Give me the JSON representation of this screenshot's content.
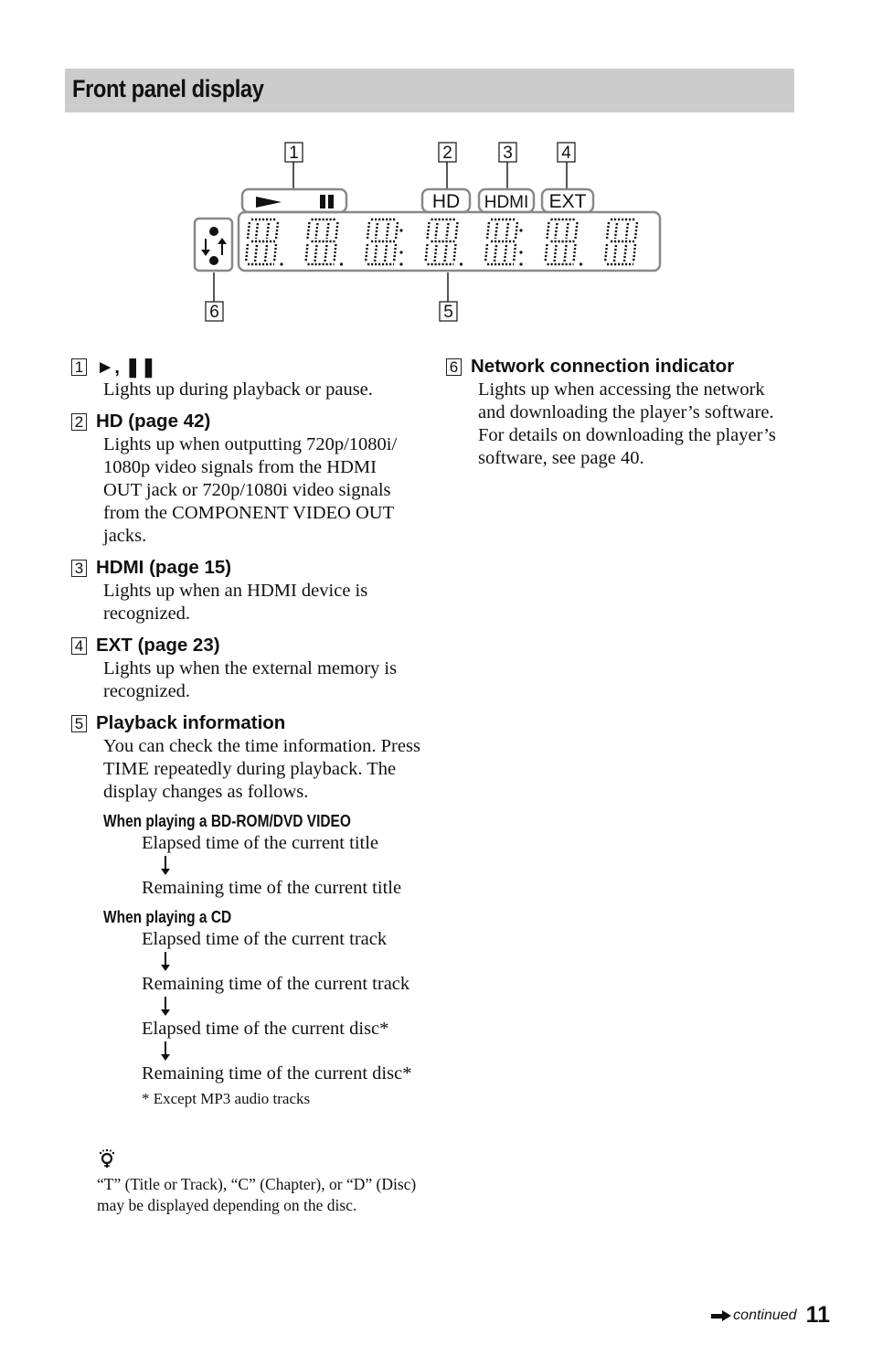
{
  "section": {
    "title": "Front panel display"
  },
  "diagram": {
    "callouts": [
      "1",
      "2",
      "3",
      "4",
      "5",
      "6"
    ],
    "indicators": {
      "hd": "HD",
      "hdmi": "HDMI",
      "ext": "EXT"
    },
    "digit_count": 7
  },
  "items": [
    {
      "num": "1",
      "title": "►, ❚❚",
      "body": "Lights up during playback or pause."
    },
    {
      "num": "2",
      "title": "HD (page 42)",
      "body": "Lights up when outputting 720p/1080i/ 1080p video signals from the HDMI OUT jack or 720p/1080i video signals from the COMPONENT VIDEO OUT jacks."
    },
    {
      "num": "3",
      "title": "HDMI (page 15)",
      "body": "Lights up when an HDMI device is recognized."
    },
    {
      "num": "4",
      "title": "EXT (page 23)",
      "body": "Lights up when the external memory is recognized."
    },
    {
      "num": "5",
      "title": "Playback information",
      "body": "You can check the time information. Press TIME repeatedly during playback. The display changes as follows."
    },
    {
      "num": "6",
      "title": "Network connection indicator",
      "body": "Lights up when accessing the network and downloading the player’s software. For details on downloading the player’s software, see page 40."
    }
  ],
  "playback": {
    "bd": {
      "heading": "When playing a BD-ROM/DVD VIDEO",
      "steps": [
        "Elapsed time of the current title",
        "Remaining time of the current title"
      ]
    },
    "cd": {
      "heading": "When playing a CD",
      "steps": [
        "Elapsed time of the current track",
        "Remaining time of the current track",
        "Elapsed time of the current disc*",
        "Remaining time of the current disc*"
      ]
    },
    "footnote": "* Except MP3 audio tracks"
  },
  "hint": {
    "icon": "lightbulb-hint-icon",
    "text": "“T” (Title or Track), “C” (Chapter), or “D” (Disc) may be displayed depending on the disc."
  },
  "footer": {
    "continued": "continued",
    "page_number": "11"
  }
}
